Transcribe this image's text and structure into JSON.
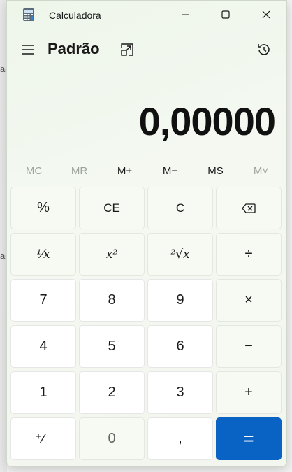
{
  "window": {
    "title": "Calculadora"
  },
  "header": {
    "mode": "Padrão"
  },
  "display": {
    "value": "0,00000"
  },
  "background_fragments": [
    "ad",
    "ac"
  ],
  "memory": [
    {
      "label": "MC",
      "enabled": false
    },
    {
      "label": "MR",
      "enabled": false
    },
    {
      "label": "M+",
      "enabled": true
    },
    {
      "label": "M−",
      "enabled": true
    },
    {
      "label": "MS",
      "enabled": true
    },
    {
      "label": "M˅",
      "enabled": false
    }
  ],
  "keys": {
    "percent": "%",
    "ce": "CE",
    "c": "C",
    "reciprocal": "¹⁄x",
    "square": "x²",
    "sqrt": "²√x",
    "divide": "÷",
    "seven": "7",
    "eight": "8",
    "nine": "9",
    "multiply": "×",
    "four": "4",
    "five": "5",
    "six": "6",
    "minus": "−",
    "one": "1",
    "two": "2",
    "three": "3",
    "plus": "+",
    "negate": "⁺⁄₋",
    "zero": "0",
    "decimal": ",",
    "equals": "="
  },
  "colors": {
    "accent": "#0863c4",
    "window_bg": "#f2f6ee"
  },
  "icons": [
    "calculator-app-icon",
    "minimize-icon",
    "maximize-icon",
    "close-icon",
    "hamburger-menu-icon",
    "keep-on-top-icon",
    "history-icon",
    "backspace-icon"
  ]
}
